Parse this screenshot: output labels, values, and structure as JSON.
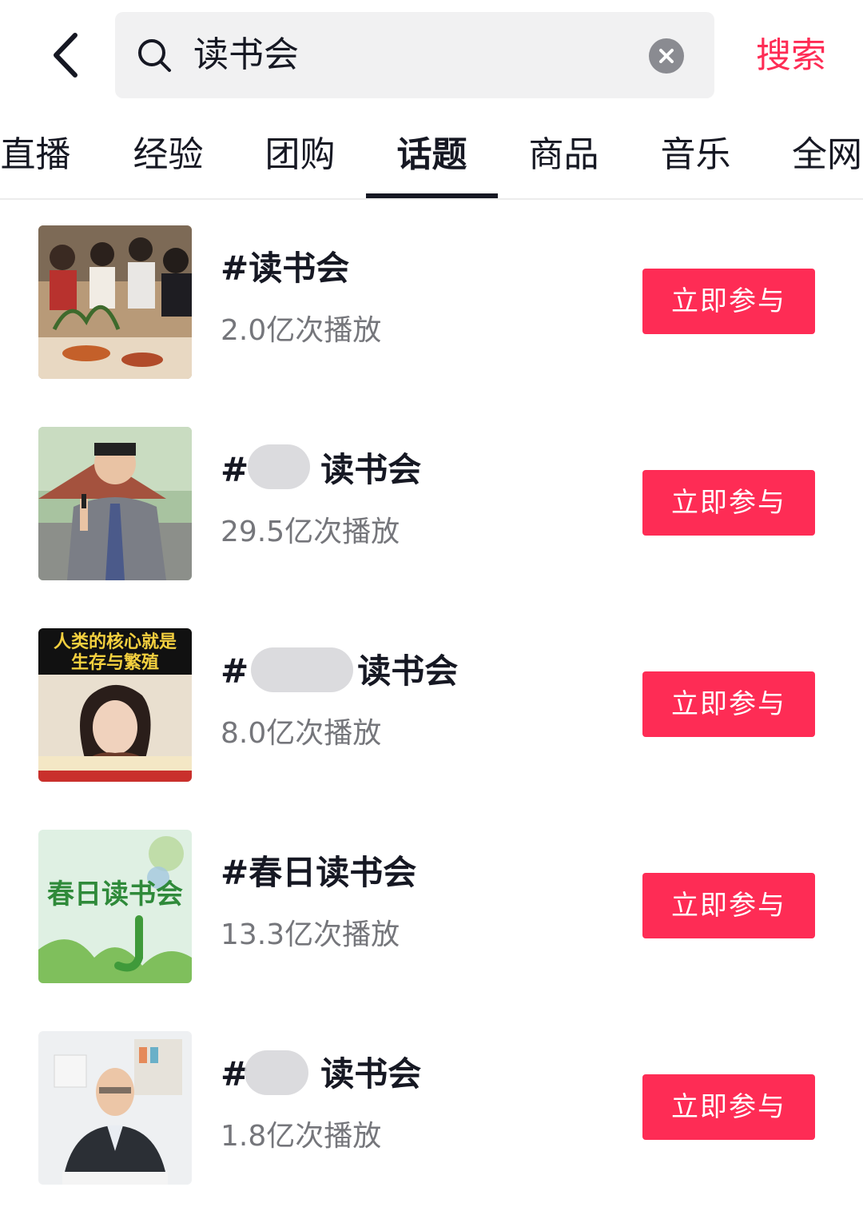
{
  "header": {
    "back_icon": "chevron-left-icon",
    "search_icon": "search-icon",
    "search_value": "读书会",
    "clear_icon": "clear-circle-icon",
    "search_button": "搜索"
  },
  "tabs": [
    {
      "label": "直播"
    },
    {
      "label": "经验"
    },
    {
      "label": "团购"
    },
    {
      "label": "话题",
      "active": true
    },
    {
      "label": "商品"
    },
    {
      "label": "音乐"
    },
    {
      "label": "全网"
    }
  ],
  "topics": [
    {
      "title": "#读书会",
      "plays": "2.0亿次播放",
      "button": "立即参与"
    },
    {
      "title": "#",
      "title_suffix": "读书会",
      "plays": "29.5亿次播放",
      "button": "立即参与"
    },
    {
      "title": "#",
      "title_suffix": "读书会",
      "plays": "8.0亿次播放",
      "button": "立即参与",
      "thumb_caption_1": "人类的核心就是",
      "thumb_caption_2": "生存与繁殖"
    },
    {
      "title": "#春日读书会",
      "plays": "13.3亿次播放",
      "button": "立即参与",
      "thumb_caption_1": "春日读书会"
    },
    {
      "title": "#",
      "title_suffix": "读书会",
      "plays": "1.8亿次播放",
      "button": "立即参与"
    }
  ],
  "colors": {
    "accent": "#fe2c55",
    "text": "#161823",
    "secondary": "#75767b",
    "search_bg": "#f1f1f2"
  }
}
